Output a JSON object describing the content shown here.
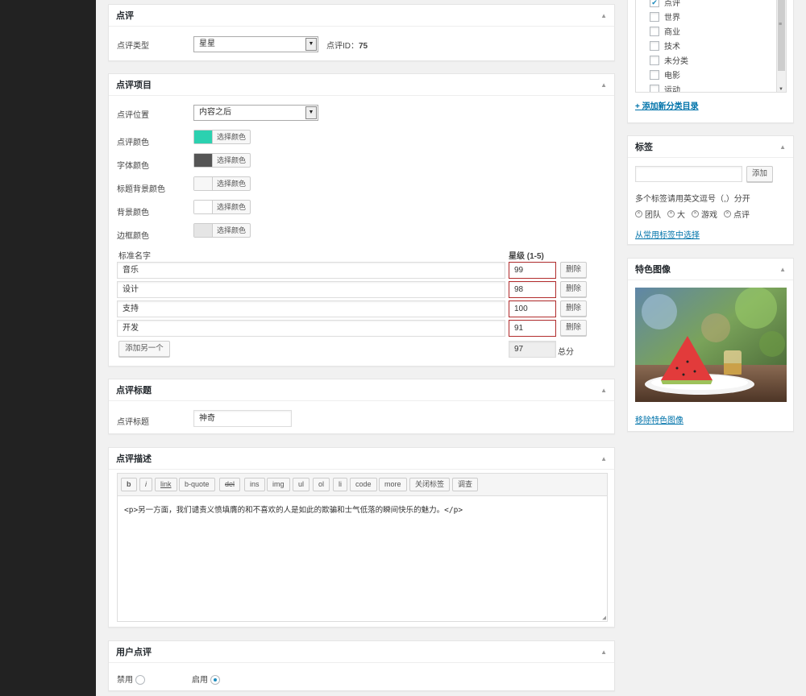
{
  "review_box": {
    "title": "点评",
    "type_label": "点评类型",
    "type_value": "星星",
    "id_label": "点评ID：",
    "id_value": "75"
  },
  "items_box": {
    "title": "点评项目",
    "position_label": "点评位置",
    "position_value": "内容之后",
    "colors": [
      {
        "label": "点评颜色",
        "button": "选择颜色",
        "swatch": "#2bd1b0"
      },
      {
        "label": "字体颜色",
        "button": "选择颜色",
        "swatch": "#555555"
      },
      {
        "label": "标题背景颜色",
        "button": "选择颜色",
        "swatch": "#f7f7f7"
      },
      {
        "label": "背景颜色",
        "button": "选择颜色",
        "swatch": "#ffffff"
      },
      {
        "label": "边框颜色",
        "button": "选择颜色",
        "swatch": "#e5e5e5"
      }
    ],
    "col_name": "标准名字",
    "col_rating": "星级 (1-5)",
    "rows": [
      {
        "name": "音乐",
        "score": "99",
        "delete": "删除"
      },
      {
        "name": "设计",
        "score": "98",
        "delete": "删除"
      },
      {
        "name": "支持",
        "score": "100",
        "delete": "删除"
      },
      {
        "name": "开发",
        "score": "91",
        "delete": "删除"
      }
    ],
    "add_button": "添加另一个",
    "total_value": "97",
    "total_label": "总分"
  },
  "title_box": {
    "title": "点评标题",
    "label": "点评标题",
    "value": "神奇"
  },
  "desc_box": {
    "title": "点评描述",
    "toolbar": [
      "b",
      "i",
      "link",
      "b-quote",
      "del",
      "ins",
      "img",
      "ul",
      "ol",
      "li",
      "code",
      "more",
      "关闭标签",
      "调查"
    ],
    "content": "<p>另一方面，我们谴责义愤填膺的和不喜欢的人是如此的欺骗和士气低落的瞬间快乐的魅力。</p>"
  },
  "user_box": {
    "title": "用户点评",
    "disable": "禁用",
    "enable": "启用",
    "selected": "enable"
  },
  "categories": {
    "items": [
      {
        "label": "点评",
        "checked": true
      },
      {
        "label": "世界",
        "checked": false
      },
      {
        "label": "商业",
        "checked": false
      },
      {
        "label": "技术",
        "checked": false
      },
      {
        "label": "未分类",
        "checked": false
      },
      {
        "label": "电影",
        "checked": false
      },
      {
        "label": "运动",
        "checked": false
      }
    ],
    "add_link": "+ 添加新分类目录"
  },
  "tags": {
    "title": "标签",
    "add_button": "添加",
    "hint": "多个标签请用英文逗号（,）分开",
    "items": [
      "团队",
      "大",
      "游戏",
      "点评"
    ],
    "choose_link": "从常用标签中选择"
  },
  "featured": {
    "title": "特色图像",
    "remove_link": "移除特色图像"
  }
}
